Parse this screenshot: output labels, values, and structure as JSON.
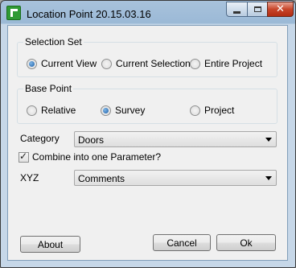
{
  "window": {
    "title": "Location Point 20.15.03.16"
  },
  "selection_set": {
    "title": "Selection Set",
    "options": [
      {
        "label": "Current View",
        "checked": true
      },
      {
        "label": "Current Selection",
        "checked": false
      },
      {
        "label": "Entire Project",
        "checked": false
      }
    ]
  },
  "base_point": {
    "title": "Base Point",
    "options": [
      {
        "label": "Relative",
        "checked": false
      },
      {
        "label": "Survey",
        "checked": true
      },
      {
        "label": "Project",
        "checked": false
      }
    ]
  },
  "category": {
    "label": "Category",
    "value": "Doors"
  },
  "combine": {
    "label": "Combine into one Parameter?",
    "checked": true
  },
  "xyz": {
    "label": "XYZ",
    "value": "Comments"
  },
  "buttons": {
    "about": "About",
    "cancel": "Cancel",
    "ok": "Ok"
  },
  "icons": {
    "app": "app-icon",
    "minimize": "minimize-icon",
    "maximize": "maximize-icon",
    "close": "close-icon",
    "dropdown": "chevron-down-icon",
    "check": "check-icon"
  }
}
